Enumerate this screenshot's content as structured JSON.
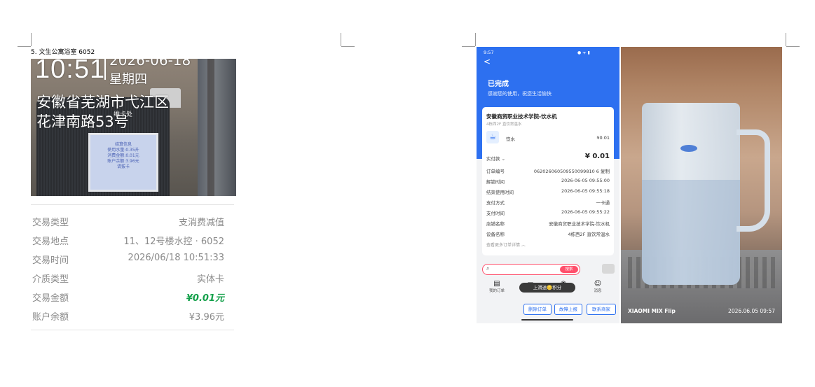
{
  "caption": "5. 文生公寓浴室 6052",
  "photo1": {
    "time": "10:51",
    "date": "2026-06-18",
    "weekday": "星期四",
    "address_line1": "安徽省芜湖市弋江区",
    "address_line2": "花津南路53号",
    "small_label": "维卡处",
    "screen_lines": [
      "结算信息",
      "使用水量:0.35升",
      "消费金额:0.01元",
      "账户余额:3.96元",
      "请拔卡"
    ]
  },
  "transaction": {
    "rows": [
      {
        "key": "交易类型",
        "value": "支消费减值"
      },
      {
        "key": "交易地点",
        "value": "11、12号楼水控 · 6052"
      },
      {
        "key": "交易时间",
        "value": "2026/06/18 10:51:33"
      },
      {
        "key": "介质类型",
        "value": "实体卡"
      },
      {
        "key": "交易金额",
        "value": "¥0.01元"
      },
      {
        "key": "账户余额",
        "value": "¥3.96元"
      }
    ]
  },
  "phone": {
    "status_time": "9:57",
    "back": "<",
    "status_title": "已完成",
    "status_sub": "感谢您的使用，祝您生活愉快",
    "shop_name": "安徽商贸职业技术学院-饮水机",
    "shop_sub": "4栋西2F 直饮常温水",
    "item_name": "饮水",
    "item_price": "¥0.01",
    "paid_label": "实付款",
    "paid_value": "¥ 0.01",
    "details": [
      {
        "key": "订单编号",
        "value": "062026060509550099810 6  复制"
      },
      {
        "key": "解锁时间",
        "value": "2026-06-05 09:55:00"
      },
      {
        "key": "结束使用时间",
        "value": "2026-06-05 09:55:18"
      },
      {
        "key": "支付方式",
        "value": "一卡通"
      },
      {
        "key": "支付时间",
        "value": "2026-06-05 09:55:22"
      },
      {
        "key": "店铺名称",
        "value": "安徽商贸职业技术学院-饮水机"
      },
      {
        "key": "设备名称",
        "value": "4栋西2F 直饮常温水"
      }
    ],
    "more": "查看更多订单详情",
    "search_btn": "搜索",
    "nav": [
      {
        "icon": "▤",
        "label": "我的订单"
      },
      {
        "icon": "▭",
        "label": ""
      },
      {
        "icon": "◉",
        "label": ""
      },
      {
        "icon": "☺",
        "label": "消息"
      }
    ],
    "pill": "上滑送🪙积分",
    "buttons": [
      "删除订单",
      "故障上报",
      "联系商家"
    ]
  },
  "photo2": {
    "watermark_left": "XIAOMI MIX Flip",
    "watermark_right": "2026.06.05 09:57"
  }
}
